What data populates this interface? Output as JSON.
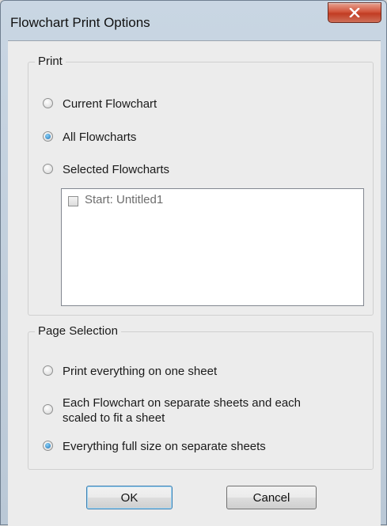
{
  "window": {
    "title": "Flowchart Print Options",
    "close_glyph": "x"
  },
  "print_group": {
    "legend": "Print",
    "options": [
      {
        "label": "Current Flowchart",
        "checked": false
      },
      {
        "label": "All Flowcharts",
        "checked": true
      },
      {
        "label": "Selected Flowcharts",
        "checked": false
      }
    ],
    "list_items": [
      {
        "label": "Start: Untitled1",
        "checked": false
      }
    ]
  },
  "page_selection_group": {
    "legend": "Page Selection",
    "options": [
      {
        "label": "Print everything on one sheet",
        "checked": false
      },
      {
        "label": "Each Flowchart on separate sheets and each scaled to fit a sheet",
        "checked": false
      },
      {
        "label": "Everything full size on separate sheets",
        "checked": true
      }
    ]
  },
  "buttons": {
    "ok": "OK",
    "cancel": "Cancel"
  }
}
